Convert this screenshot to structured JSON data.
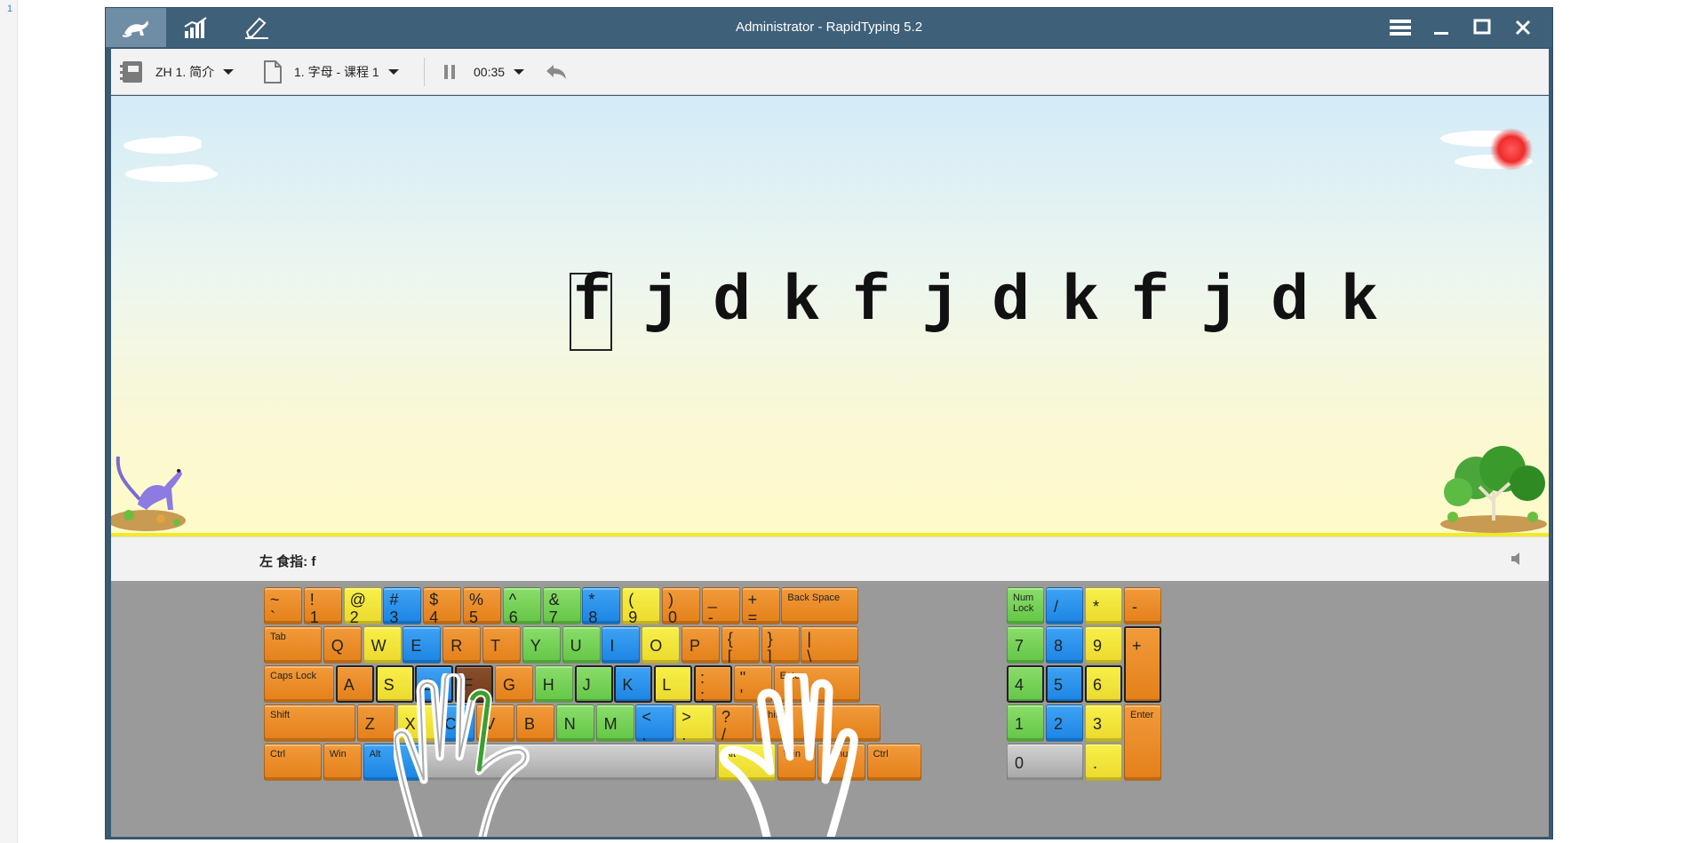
{
  "gutter": {
    "line_number": "1"
  },
  "window": {
    "title": "Administrator - RapidTyping 5.2"
  },
  "titlebar": {
    "tabs": [
      {
        "icon": "jerboa-icon",
        "active": true
      },
      {
        "icon": "statistics-icon",
        "active": false
      },
      {
        "icon": "editor-icon",
        "active": false
      }
    ],
    "controls": [
      "menu-icon",
      "minimize-icon",
      "maximize-icon",
      "close-icon"
    ]
  },
  "toolbar": {
    "course": "ZH 1. 简介",
    "lesson": "1. 字母 - 课程 1",
    "timer": "00:35"
  },
  "exercise": {
    "letters": [
      "f",
      "j",
      "d",
      "k",
      "f",
      "j",
      "d",
      "k",
      "f",
      "j",
      "d",
      "k"
    ],
    "current_index": 0
  },
  "status": {
    "hint": "左 食指: f"
  },
  "colors": {
    "orange": "#e98a27",
    "yellow": "#f2e43a",
    "green": "#74d256",
    "blue": "#2b93ec",
    "gray": "#bcbcbc",
    "highlight": "#7a4323",
    "titlebar": "#3f6079"
  },
  "keyboard": {
    "main": [
      [
        {
          "t": "~",
          "b": "`",
          "c": "o"
        },
        {
          "t": "!",
          "b": "1",
          "c": "o"
        },
        {
          "t": "@",
          "b": "2",
          "c": "y"
        },
        {
          "t": "#",
          "b": "3",
          "c": "b"
        },
        {
          "t": "$",
          "b": "4",
          "c": "o"
        },
        {
          "t": "%",
          "b": "5",
          "c": "o"
        },
        {
          "t": "^",
          "b": "6",
          "c": "g"
        },
        {
          "t": "&",
          "b": "7",
          "c": "g"
        },
        {
          "t": "*",
          "b": "8",
          "c": "b"
        },
        {
          "t": "(",
          "b": "9",
          "c": "y"
        },
        {
          "t": ")",
          "b": "0",
          "c": "o"
        },
        {
          "t": "_",
          "b": "-",
          "c": "o"
        },
        {
          "t": "+",
          "b": "=",
          "c": "o"
        },
        {
          "s": "Back Space",
          "c": "o"
        }
      ],
      [
        {
          "s": "Tab",
          "c": "o"
        },
        {
          "m": "Q",
          "c": "o"
        },
        {
          "m": "W",
          "c": "y"
        },
        {
          "m": "E",
          "c": "b"
        },
        {
          "m": "R",
          "c": "o"
        },
        {
          "m": "T",
          "c": "o"
        },
        {
          "m": "Y",
          "c": "g"
        },
        {
          "m": "U",
          "c": "g"
        },
        {
          "m": "I",
          "c": "b"
        },
        {
          "m": "O",
          "c": "y"
        },
        {
          "m": "P",
          "c": "o"
        },
        {
          "t": "{",
          "b": "[",
          "c": "o"
        },
        {
          "t": "}",
          "b": "]",
          "c": "o"
        },
        {
          "t": "|",
          "b": "\\",
          "c": "o"
        }
      ],
      [
        {
          "s": "Caps Lock",
          "c": "o"
        },
        {
          "m": "A",
          "c": "o",
          "h": true
        },
        {
          "m": "S",
          "c": "y",
          "h": true
        },
        {
          "m": "D",
          "c": "b",
          "h": true
        },
        {
          "m": "F",
          "c": "br",
          "h": true
        },
        {
          "m": "G",
          "c": "o"
        },
        {
          "m": "H",
          "c": "g"
        },
        {
          "m": "J",
          "c": "g",
          "h": true
        },
        {
          "m": "K",
          "c": "b",
          "h": true
        },
        {
          "m": "L",
          "c": "y",
          "h": true
        },
        {
          "t": ":",
          "b": ";",
          "c": "o",
          "h": true
        },
        {
          "t": "\"",
          "b": "'",
          "c": "o"
        },
        {
          "s": "Enter",
          "c": "o"
        }
      ],
      [
        {
          "s": "Shift",
          "c": "o"
        },
        {
          "m": "Z",
          "c": "o"
        },
        {
          "m": "X",
          "c": "y"
        },
        {
          "m": "C",
          "c": "b"
        },
        {
          "m": "V",
          "c": "o"
        },
        {
          "m": "B",
          "c": "o"
        },
        {
          "m": "N",
          "c": "g"
        },
        {
          "m": "M",
          "c": "g"
        },
        {
          "t": "<",
          "b": ",",
          "c": "b"
        },
        {
          "t": ">",
          "b": ".",
          "c": "y"
        },
        {
          "t": "?",
          "b": "/",
          "c": "o"
        },
        {
          "s": "Shift",
          "c": "o"
        }
      ],
      [
        {
          "s": "Ctrl",
          "c": "o"
        },
        {
          "s": "Win",
          "c": "o"
        },
        {
          "s": "Alt",
          "c": "b"
        },
        {
          "s": "",
          "c": "gr"
        },
        {
          "s": "Alt",
          "c": "y"
        },
        {
          "s": "Win",
          "c": "o"
        },
        {
          "s": "Menu",
          "c": "o"
        },
        {
          "s": "Ctrl",
          "c": "o"
        }
      ]
    ],
    "numpad": [
      {
        "s": "Num\nLock",
        "c": "g"
      },
      {
        "m": "/",
        "c": "b"
      },
      {
        "m": "*",
        "c": "y"
      },
      {
        "m": "-",
        "c": "o"
      },
      {
        "m": "7",
        "c": "g"
      },
      {
        "m": "8",
        "c": "b"
      },
      {
        "m": "9",
        "c": "y"
      },
      {
        "m": "+",
        "c": "o",
        "h": true
      },
      {
        "m": "4",
        "c": "g",
        "h": true
      },
      {
        "m": "5",
        "c": "b",
        "h": true
      },
      {
        "m": "6",
        "c": "y",
        "h": true
      },
      {
        "m": "1",
        "c": "g"
      },
      {
        "m": "2",
        "c": "b"
      },
      {
        "m": "3",
        "c": "y"
      },
      {
        "s": "Enter",
        "c": "o"
      },
      {
        "m": "0",
        "c": "gr"
      },
      {
        "m": ".",
        "c": "y"
      }
    ]
  }
}
